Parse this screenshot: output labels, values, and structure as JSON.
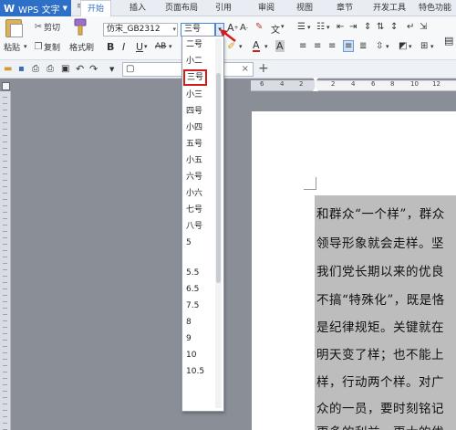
{
  "app": {
    "name": "WPS 文字",
    "logo": "W"
  },
  "tabs": [
    "开始",
    "插入",
    "页面布局",
    "引用",
    "审阅",
    "视图",
    "章节",
    "开发工具",
    "特色功能"
  ],
  "ribbon": {
    "paste_label": "粘贴",
    "cut_label": "剪切",
    "copy_label": "复制",
    "format_painter_label": "格式刷",
    "font_name": "仿宋_GB2312",
    "font_size": "三号"
  },
  "font_size_options": [
    "二号",
    "小二",
    "三号",
    "小三",
    "四号",
    "小四",
    "五号",
    "小五",
    "六号",
    "小六",
    "七号",
    "八号",
    "5",
    "5.5",
    "6.5",
    "7.5",
    "8",
    "9",
    "10",
    "10.5"
  ],
  "selected_size": "三号",
  "ruler_numbers": [
    "6",
    "4",
    "2",
    "2",
    "4",
    "6",
    "8",
    "10",
    "12"
  ],
  "document_lines": [
    "和群众“一个样”，群众",
    "领导形象就会走样。坚",
    "我们党长期以来的优良",
    "不搞“特殊化”，既是恪",
    "是纪律规矩。关键就在",
    "明天变了样；也不能上",
    "样，行动两个样。对广",
    "众的一员，要时刻铭记",
    "更多的利益，更大的优"
  ]
}
